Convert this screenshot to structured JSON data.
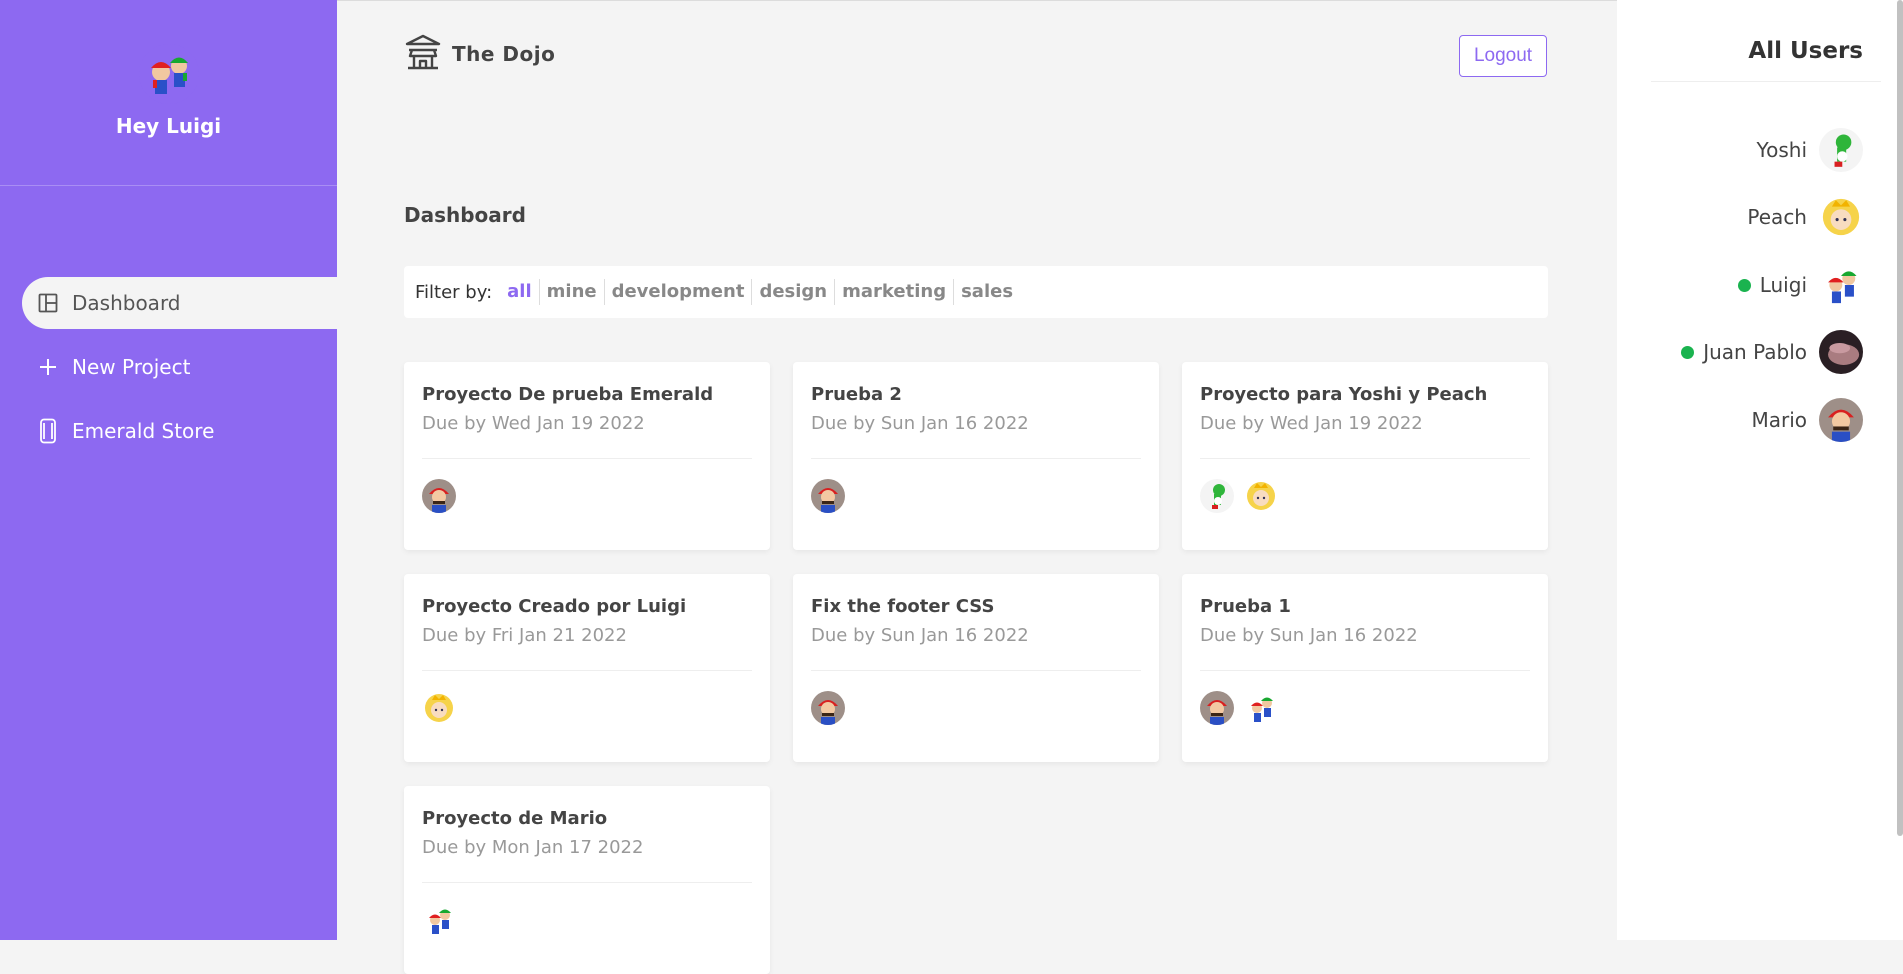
{
  "sidebar": {
    "greeting": "Hey Luigi",
    "nav": [
      {
        "label": "Dashboard",
        "icon": "dashboard-icon",
        "active": true
      },
      {
        "label": "New Project",
        "icon": "plus-icon",
        "active": false
      },
      {
        "label": "Emerald Store",
        "icon": "phone-icon",
        "active": false
      }
    ]
  },
  "header": {
    "brand": "The Dojo",
    "logout": "Logout"
  },
  "page": {
    "title": "Dashboard",
    "filter_label": "Filter by:",
    "filters": [
      "all",
      "mine",
      "development",
      "design",
      "marketing",
      "sales"
    ],
    "active_filter": "all"
  },
  "projects": [
    {
      "title": "Proyecto De prueba Emerald",
      "due": "Due by Wed Jan 19 2022",
      "members": [
        "Mario"
      ]
    },
    {
      "title": "Prueba 2",
      "due": "Due by Sun Jan 16 2022",
      "members": [
        "Mario"
      ]
    },
    {
      "title": "Proyecto para Yoshi y Peach",
      "due": "Due by Wed Jan 19 2022",
      "members": [
        "Yoshi",
        "Peach"
      ]
    },
    {
      "title": "Proyecto Creado por Luigi",
      "due": "Due by Fri Jan 21 2022",
      "members": [
        "Peach"
      ]
    },
    {
      "title": "Fix the footer CSS",
      "due": "Due by Sun Jan 16 2022",
      "members": [
        "Mario"
      ]
    },
    {
      "title": "Prueba 1",
      "due": "Due by Sun Jan 16 2022",
      "members": [
        "Mario",
        "Luigi"
      ]
    },
    {
      "title": "Proyecto de Mario",
      "due": "Due by Mon Jan 17 2022",
      "members": [
        "Luigi"
      ]
    }
  ],
  "users_panel": {
    "title": "All Users",
    "users": [
      {
        "name": "Yoshi",
        "online": false
      },
      {
        "name": "Peach",
        "online": false
      },
      {
        "name": "Luigi",
        "online": true
      },
      {
        "name": "Juan Pablo",
        "online": true
      },
      {
        "name": "Mario",
        "online": false
      }
    ]
  },
  "colors": {
    "accent": "#8d69f1",
    "online": "#1ab34f",
    "background": "#f4f4f4"
  }
}
